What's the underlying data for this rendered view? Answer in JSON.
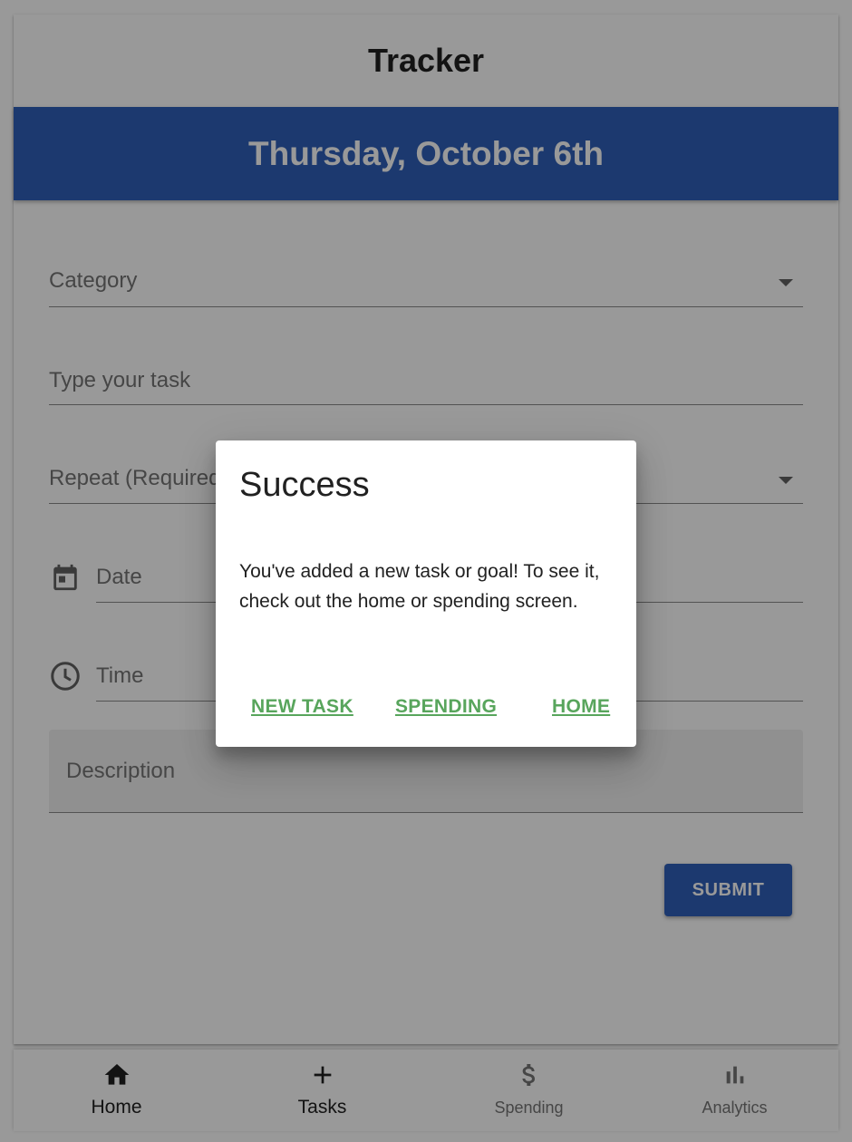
{
  "app": {
    "title": "Tracker",
    "date_banner": "Thursday, October 6th"
  },
  "form": {
    "category_label": "Category",
    "task_label": "Type your task",
    "repeat_label": "Repeat (Required)",
    "date_label": "Date",
    "time_label": "Time",
    "description_label": "Description",
    "submit_label": "SUBMIT"
  },
  "dialog": {
    "title": "Success",
    "body": "You've added a new task or goal! To see it, check out the home or spending screen.",
    "buttons": {
      "new_task": "NEW TASK",
      "spending": "SPENDING",
      "home": "HOME"
    }
  },
  "bottom_nav": {
    "items": [
      {
        "label": "Home",
        "icon": "home-icon",
        "active": true
      },
      {
        "label": "Tasks",
        "icon": "plus-icon",
        "active": true
      },
      {
        "label": "Spending",
        "icon": "dollar-icon",
        "active": false
      },
      {
        "label": "Analytics",
        "icon": "bar-chart-icon",
        "active": false
      }
    ]
  },
  "colors": {
    "primary": "#2f5fb9",
    "dialog_button": "#58a55c",
    "overlay": "rgba(0,0,0,0.4)"
  }
}
